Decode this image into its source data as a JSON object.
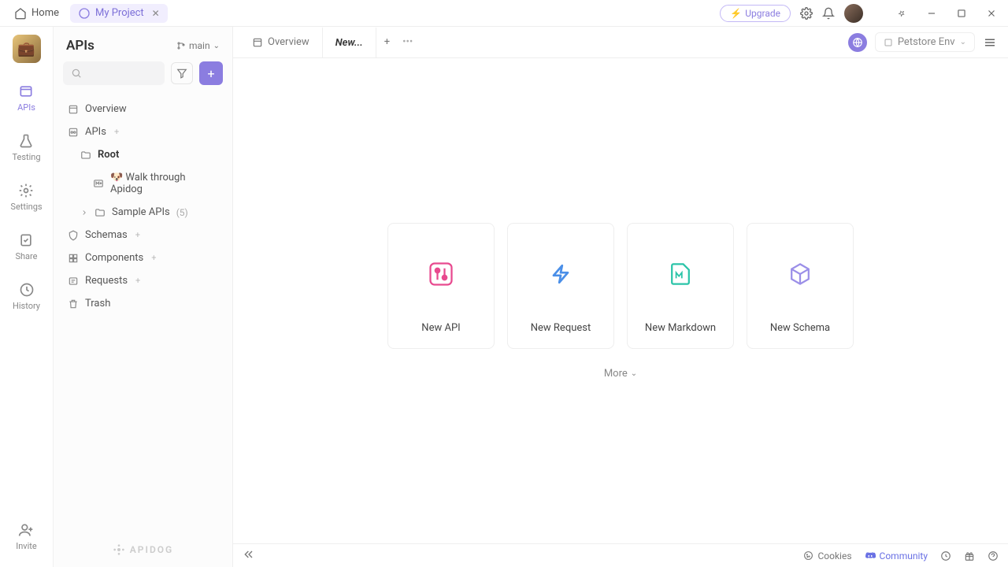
{
  "titlebar": {
    "home": "Home",
    "project": "My Project",
    "upgrade": "Upgrade"
  },
  "iconbar": {
    "items": [
      {
        "label": "APIs"
      },
      {
        "label": "Testing"
      },
      {
        "label": "Settings"
      },
      {
        "label": "Share"
      },
      {
        "label": "History"
      },
      {
        "label": "Invite"
      }
    ]
  },
  "treebar": {
    "title": "APIs",
    "branch": "main",
    "overview": "Overview",
    "apis": "APIs",
    "root": "Root",
    "walkthrough": "🐶 Walk through Apidog",
    "sample": "Sample APIs",
    "sample_count": "(5)",
    "schemas": "Schemas",
    "components": "Components",
    "requests": "Requests",
    "trash": "Trash",
    "brand": "APIDOG"
  },
  "tabs": {
    "overview": "Overview",
    "new": "New...",
    "env": "Petstore Env"
  },
  "cards": [
    {
      "label": "New API"
    },
    {
      "label": "New Request"
    },
    {
      "label": "New Markdown"
    },
    {
      "label": "New Schema"
    }
  ],
  "more": "More",
  "statusbar": {
    "cookies": "Cookies",
    "community": "Community"
  }
}
